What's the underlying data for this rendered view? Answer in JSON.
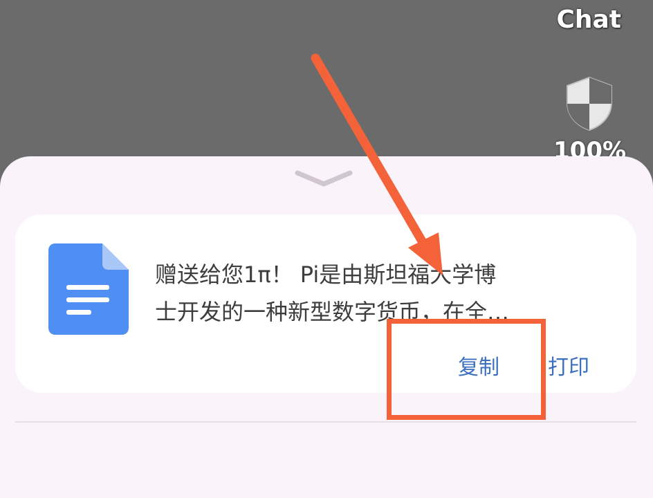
{
  "status": {
    "app_label": "Chat",
    "shield_icon": "shield-icon",
    "battery": "100%"
  },
  "share_sheet": {
    "handle_icon": "chevron-down-icon",
    "file_icon": "document-icon",
    "message_line1": "赠送给您1π！ Pi是由斯坦福大学博",
    "message_line2": "士开发的一种新型数字货币，在全…",
    "copy_label": "复制",
    "print_label": "打印"
  },
  "annotation": {
    "color": "#f4623a"
  },
  "colors": {
    "sheet_bg": "#fbf3fa",
    "card_bg": "#ffffff",
    "action_text": "#3b6fbf",
    "doc_blue": "#4f8ef2"
  }
}
